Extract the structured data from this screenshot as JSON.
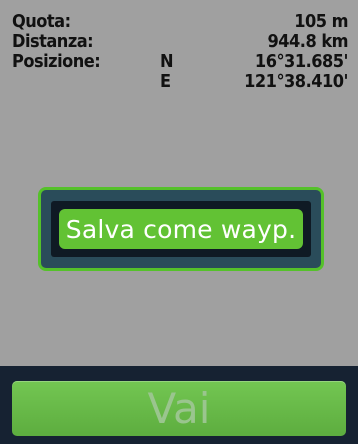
{
  "info": {
    "rows": [
      {
        "label": "Quota:",
        "direction": "",
        "value": "105 m"
      },
      {
        "label": "Distanza:",
        "direction": "",
        "value": "944.8 km"
      },
      {
        "label": "Posizione:",
        "direction": "N",
        "value": "16°31.685'"
      },
      {
        "label": "",
        "direction": "E",
        "value": "121°38.410'"
      }
    ]
  },
  "dialog": {
    "save_label": "Salva come wayp."
  },
  "bottom": {
    "go_label": "Vai"
  },
  "colors": {
    "background": "#a0a0a0",
    "dialog_border": "#55c12a",
    "dialog_bg": "#2a4c5a",
    "accent_green": "#62c234",
    "bottom_bar": "#162232"
  }
}
